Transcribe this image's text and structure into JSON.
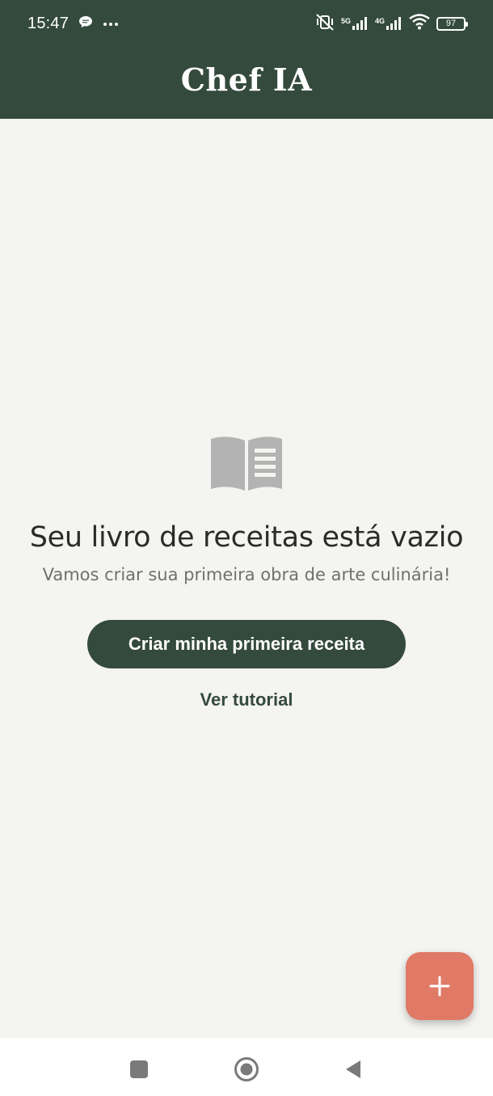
{
  "status_bar": {
    "time": "15:47",
    "network_5g": "5G",
    "network_4g": "4G",
    "battery": "97"
  },
  "app": {
    "title": "Chef IA"
  },
  "empty_state": {
    "icon": "open-book-icon",
    "title": "Seu livro de receitas está vazio",
    "subtitle": "Vamos criar sua primeira obra de arte culinária!",
    "primary_button": "Criar minha primeira receita",
    "secondary_link": "Ver tutorial"
  },
  "fab": {
    "icon": "plus-icon"
  },
  "nav_bar": {
    "items": [
      "recents-square-icon",
      "home-circle-icon",
      "back-triangle-icon"
    ]
  },
  "colors": {
    "primary": "#344a3d",
    "background": "#f4f4f1",
    "accent": "#e07a67"
  }
}
